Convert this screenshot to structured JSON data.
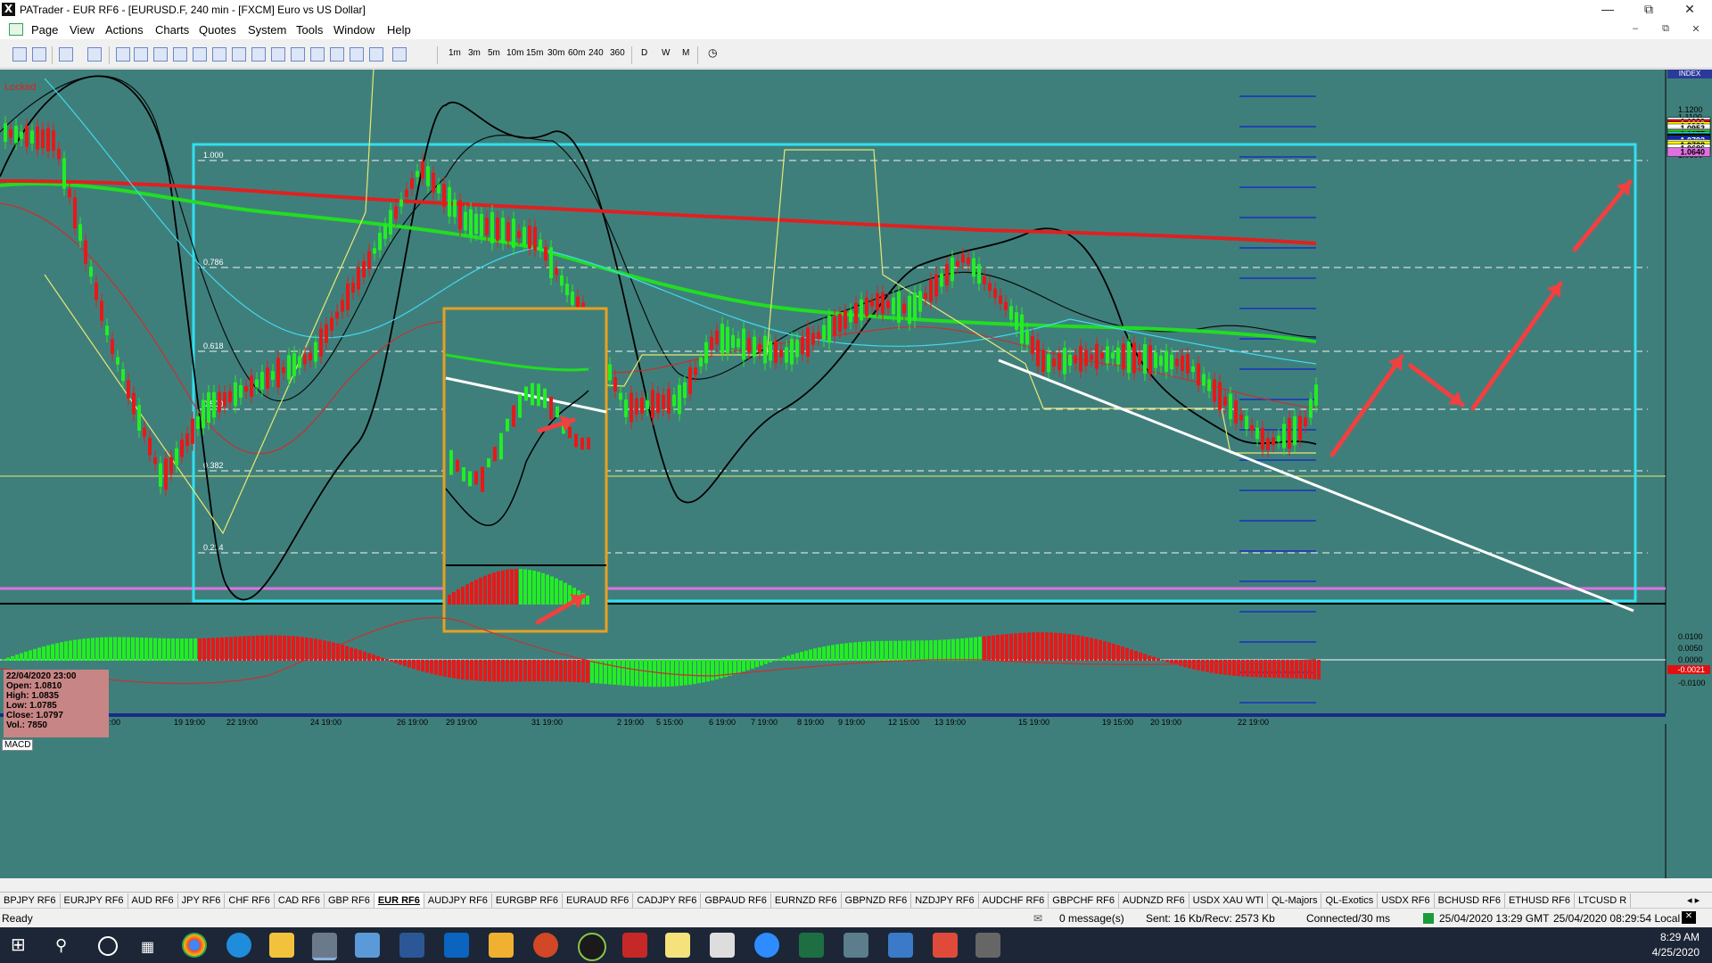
{
  "window": {
    "title": "PATrader - EUR RF6 - [EURUSD.F, 240 min - [FXCM] Euro vs US Dollar]",
    "app_icon": "X"
  },
  "menu": [
    "Page",
    "View",
    "Actions",
    "Charts",
    "Quotes",
    "System",
    "Tools",
    "Window",
    "Help"
  ],
  "toolbar": {
    "timeframes": [
      "1m",
      "3m",
      "5m",
      "10m",
      "15m",
      "30m",
      "60m",
      "240",
      "360"
    ],
    "periods": [
      "D",
      "W",
      "M"
    ]
  },
  "chart": {
    "locked_label": "Locked",
    "index_label": "INDEX",
    "macd_label": "MACD",
    "info": {
      "date": "22/04/2020 23:00",
      "open": "Open: 1.0810",
      "high": "High: 1.0835",
      "low": "Low: 1.0785",
      "close": "Close: 1.0797",
      "vol": "Vol.: 7850"
    },
    "fib_levels": [
      "1.000",
      "0.786",
      "0.618",
      "0.500",
      "0.382",
      "0.214"
    ],
    "price_ticks": [
      "1.1200",
      "1.1100",
      "1.1000",
      "1.0900",
      "1.0700",
      "1.0600"
    ],
    "price_markers": [
      {
        "label": "1.1039",
        "bg": "#ffffff",
        "fg": "#000000"
      },
      {
        "label": "1.1012",
        "bg": "#e01010",
        "fg": "#ffffff"
      },
      {
        "label": "1.0980",
        "bg": "#ffff00",
        "fg": "#000000"
      },
      {
        "label": "1.0953",
        "bg": "#ffffff",
        "fg": "#000000"
      },
      {
        "label": "1.0893",
        "bg": "#ffffff",
        "fg": "#000000"
      },
      {
        "label": "1.0877",
        "bg": "#20d020",
        "fg": "#000000"
      },
      {
        "label": "1.0848",
        "bg": "#40e0ff",
        "fg": "#000000"
      },
      {
        "label": "1.0825",
        "bg": "#000000",
        "fg": "#ffffff"
      },
      {
        "label": "1.0802",
        "bg": "#20d020",
        "fg": "#000000"
      },
      {
        "label": "1.0793",
        "bg": "#1020c0",
        "fg": "#ffffff"
      },
      {
        "label": "1.0747",
        "bg": "#ffffff",
        "fg": "#000000"
      },
      {
        "label": "1.0728",
        "bg": "#ffff00",
        "fg": "#000000"
      },
      {
        "label": "1.0686",
        "bg": "#ffffff",
        "fg": "#000000"
      },
      {
        "label": "1.0640",
        "bg": "#e070e0",
        "fg": "#000000"
      }
    ],
    "macd_ticks": [
      "0.0100",
      "0.0050",
      "0.0000",
      "-0.0050",
      "-0.0100"
    ],
    "macd_marker": "-0.0021",
    "time_labels": [
      "19:00",
      "17 19:00",
      "19 19:00",
      "22 19:00",
      "24 19:00",
      "26 19:00",
      "29 19:00",
      "31 19:00",
      "2 19:00",
      "5 15:00",
      "6 19:00",
      "7 19:00",
      "8 19:00",
      "9 19:00",
      "12 15:00",
      "13 19:00",
      "15 19:00",
      "19 15:00",
      "20 19:00",
      "22 19:00"
    ]
  },
  "tabs": [
    "BPJPY RF6",
    "EURJPY RF6",
    "AUD RF6",
    "JPY RF6",
    "CHF RF6",
    "CAD RF6",
    "GBP RF6",
    "EUR RF6",
    "AUDJPY RF6",
    "EURGBP RF6",
    "EURAUD RF6",
    "CADJPY RF6",
    "GBPAUD RF6",
    "EURNZD RF6",
    "GBPNZD RF6",
    "NZDJPY RF6",
    "AUDCHF RF6",
    "GBPCHF RF6",
    "AUDNZD RF6",
    "USDX XAU WTI",
    "QL-Majors",
    "QL-Exotics",
    "USDX RF6",
    "BCHUSD RF6",
    "ETHUSD RF6",
    "LTCUSD R"
  ],
  "active_tab": "EUR RF6",
  "status": {
    "ready": "Ready",
    "messages": "0 message(s)",
    "traffic": "Sent: 16 Kb/Recv: 2573 Kb",
    "connection": "Connected/30 ms",
    "server_time": "25/04/2020 13:29 GMT",
    "local_time": "25/04/2020 08:29:54 Local"
  },
  "taskbar": {
    "time": "8:29 AM",
    "date": "4/25/2020"
  }
}
